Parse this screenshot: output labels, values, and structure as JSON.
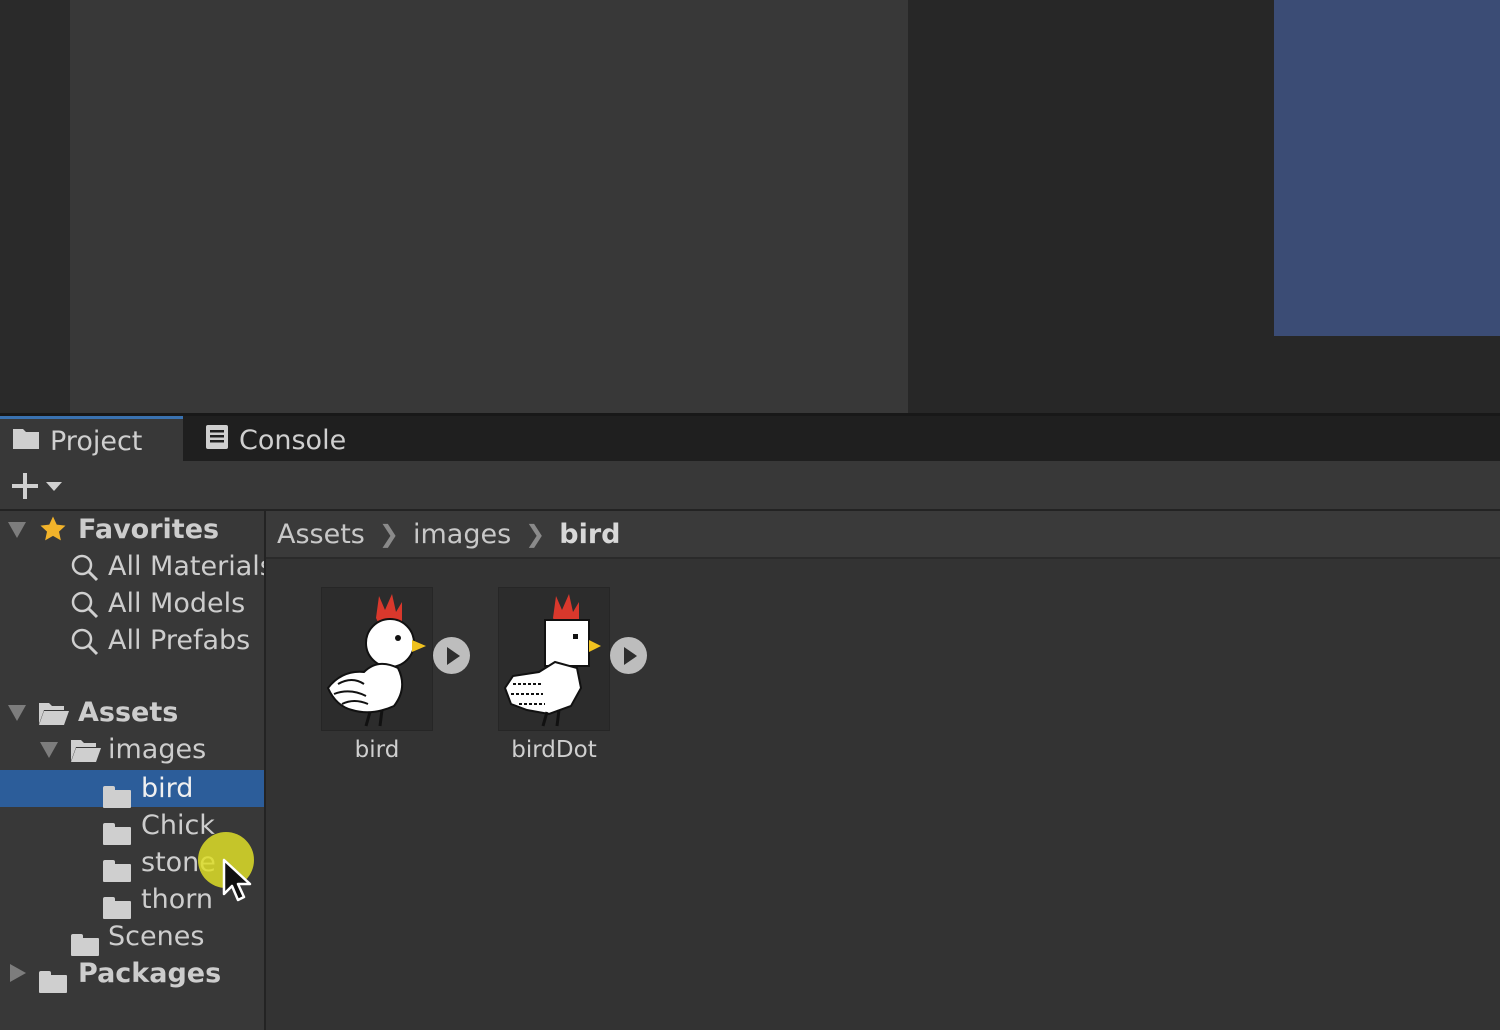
{
  "tabs": [
    {
      "label": "Project",
      "icon": "folder-icon",
      "active": true
    },
    {
      "label": "Console",
      "icon": "console-icon",
      "active": false
    }
  ],
  "toolbar": {
    "add_icon": "plus-icon"
  },
  "tree": {
    "favorites": {
      "label": "Favorites",
      "items": [
        {
          "label": "All Materials"
        },
        {
          "label": "All Models"
        },
        {
          "label": "All Prefabs"
        }
      ]
    },
    "assets": {
      "label": "Assets",
      "images": {
        "label": "images",
        "children": [
          {
            "label": "bird",
            "selected": true
          },
          {
            "label": "Chick"
          },
          {
            "label": "stone"
          },
          {
            "label": "thorn"
          }
        ]
      },
      "scenes": {
        "label": "Scenes"
      }
    },
    "packages": {
      "label": "Packages"
    }
  },
  "breadcrumb": [
    "Assets",
    "images",
    "bird"
  ],
  "assets_grid": [
    {
      "name": "bird"
    },
    {
      "name": "birdDot"
    }
  ],
  "colors": {
    "selection": "#2c5d9a",
    "scene_preview": "#3b4c75",
    "star": "#f2b32a",
    "cursor_highlight": "#dede28"
  }
}
